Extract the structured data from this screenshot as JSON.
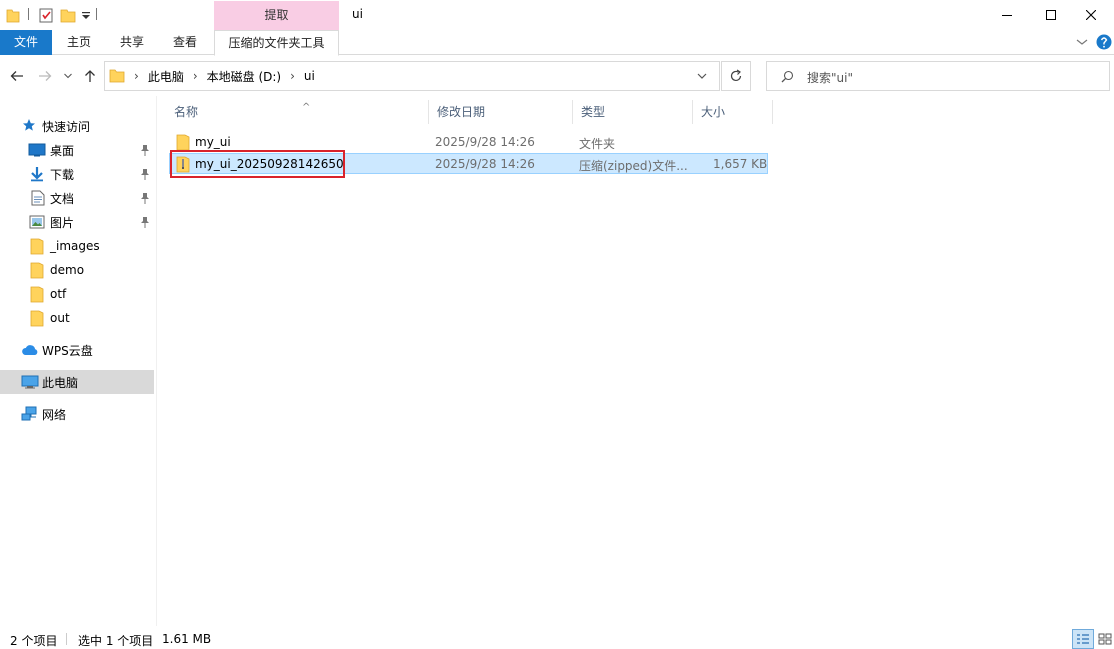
{
  "window": {
    "title": "ui",
    "context_header": "提取",
    "controls": {
      "minimize": "minimize-icon",
      "maximize": "maximize-icon",
      "close": "close-icon"
    }
  },
  "ribbon": {
    "tabs": [
      {
        "label": "文件"
      },
      {
        "label": "主页"
      },
      {
        "label": "共享"
      },
      {
        "label": "查看"
      },
      {
        "label": "压缩的文件夹工具"
      }
    ]
  },
  "address": {
    "breadcrumbs": [
      "此电脑",
      "本地磁盘 (D:)",
      "ui"
    ],
    "search_placeholder": "搜索\"ui\""
  },
  "nav": {
    "items": [
      {
        "label": "快速访问",
        "icon": "star-icon",
        "pinned": false
      },
      {
        "label": "桌面",
        "icon": "desktop-icon",
        "pinned": true
      },
      {
        "label": "下载",
        "icon": "download-icon",
        "pinned": true
      },
      {
        "label": "文档",
        "icon": "document-icon",
        "pinned": true
      },
      {
        "label": "图片",
        "icon": "pictures-icon",
        "pinned": true
      },
      {
        "label": "_images",
        "icon": "folder-icon",
        "pinned": false
      },
      {
        "label": "demo",
        "icon": "folder-icon",
        "pinned": false
      },
      {
        "label": "otf",
        "icon": "folder-icon",
        "pinned": false
      },
      {
        "label": "out",
        "icon": "folder-icon",
        "pinned": false
      },
      {
        "label": "WPS云盘",
        "icon": "cloud-icon",
        "pinned": false
      },
      {
        "label": "此电脑",
        "icon": "computer-icon",
        "pinned": false,
        "selected": true
      },
      {
        "label": "网络",
        "icon": "network-icon",
        "pinned": false
      }
    ]
  },
  "list": {
    "columns": {
      "name": "名称",
      "date": "修改日期",
      "type": "类型",
      "size": "大小"
    },
    "files": [
      {
        "name": "my_ui",
        "date": "2025/9/28 14:26",
        "type": "文件夹",
        "size": "",
        "icon": "folder-icon"
      },
      {
        "name": "my_ui_20250928142650",
        "date": "2025/9/28 14:26",
        "type": "压缩(zipped)文件...",
        "size": "1,657 KB",
        "icon": "zip-folder-icon",
        "selected": true
      }
    ]
  },
  "status": {
    "item_count": "2 个项目",
    "selection": "选中 1 个项目",
    "selection_size": "1.61 MB"
  },
  "colors": {
    "accent": "#1979ca",
    "context_tab": "#f9cde4",
    "selection": "#cce8ff",
    "highlight": "#d9232b"
  }
}
